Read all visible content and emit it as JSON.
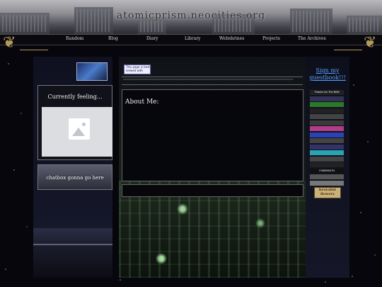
{
  "header": {
    "title": "atomicprism.neocities.org"
  },
  "nav": {
    "items": [
      {
        "label": "Random"
      },
      {
        "label": "Blog"
      },
      {
        "label": "Diary"
      },
      {
        "label": "Library"
      },
      {
        "label": "Webshrines"
      },
      {
        "label": "Projects"
      },
      {
        "label": "The Archives"
      }
    ]
  },
  "left": {
    "blinkie_label": "",
    "feeling": {
      "title": "Currently feeling..."
    },
    "chatbox": {
      "label": "chatbox gonna go here"
    }
  },
  "center": {
    "badge_text": "This page is best viewed with",
    "divider": "~~~~~~~~~~~~~~~~~~~~~~~~~~~~~~~~~~~~~~~~~~~~~~~~~~~~~~~~~~~~~~~~~~~~~~~~~~~~~~~~~~~~~~~~~~~~",
    "about": {
      "title": "About Me:"
    }
  },
  "right": {
    "guestbook": "Sign my guestbook!!!",
    "stamps": [
      {
        "text": "Thanks for The RAM",
        "bg": "#222"
      },
      {
        "text": "",
        "bg": "#335"
      },
      {
        "text": "",
        "bg": "#2a7a2a"
      },
      {
        "text": "",
        "bg": "#222"
      },
      {
        "text": "",
        "bg": "#444"
      },
      {
        "text": "",
        "bg": "#3a3a3a"
      },
      {
        "text": "",
        "bg": "#b23c8a"
      },
      {
        "text": "",
        "bg": "#2a44b2"
      },
      {
        "text": "",
        "bg": "#444"
      },
      {
        "text": "",
        "bg": "#336"
      },
      {
        "text": "",
        "bg": "#2aa4b2"
      },
      {
        "text": "",
        "bg": "#444"
      },
      {
        "text": "",
        "bg": "#222"
      },
      {
        "text": "CYBERMOTH",
        "bg": "#111"
      },
      {
        "text": "",
        "bg": "#555"
      },
      {
        "text": "",
        "bg": "#777"
      }
    ],
    "big_stamp": "brutalist flowers"
  }
}
